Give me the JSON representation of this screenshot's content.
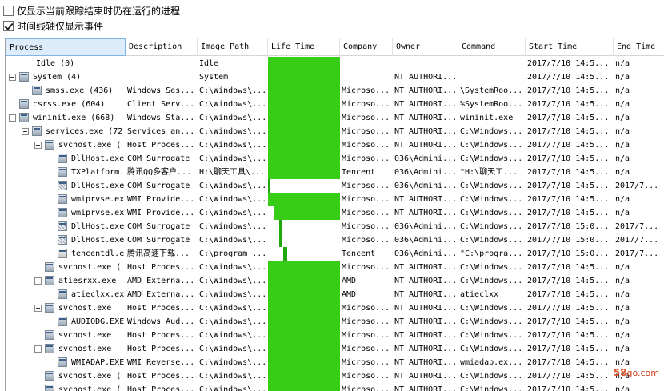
{
  "options": {
    "only_running": {
      "label": "仅显示当前跟踪结束时仍在运行的进程",
      "checked": false
    },
    "timeline_only": {
      "label": "时间线轴仅显示事件",
      "checked": true
    }
  },
  "columns": [
    "Process",
    "Description",
    "Image Path",
    "Life Time",
    "Company",
    "Owner",
    "Command",
    "Start Time",
    "End Time"
  ],
  "rows": [
    {
      "depth": 0,
      "expand": false,
      "icon": "none",
      "process": "Idle (0)",
      "description": "",
      "image_path": "Idle",
      "lifetime": {
        "start": 0,
        "end": 1
      },
      "company": "",
      "owner": "",
      "command": "",
      "start_time": "2017/7/10 14:5...",
      "end_time": "n/a"
    },
    {
      "depth": 0,
      "expand": true,
      "icon": "process",
      "process": "System (4)",
      "description": "",
      "image_path": "System",
      "lifetime": {
        "start": 0,
        "end": 1
      },
      "company": "",
      "owner": "NT AUTHORI...",
      "command": "",
      "start_time": "2017/7/10 14:5...",
      "end_time": "n/a"
    },
    {
      "depth": 1,
      "expand": false,
      "icon": "process",
      "process": "smss.exe (436)",
      "description": "Windows Ses...",
      "image_path": "C:\\Windows\\...",
      "lifetime": {
        "start": 0,
        "end": 1
      },
      "company": "Microso...",
      "owner": "NT AUTHORI...",
      "command": "\\SystemRoo...",
      "start_time": "2017/7/10 14:5...",
      "end_time": "n/a"
    },
    {
      "depth": 0,
      "expand": false,
      "icon": "process",
      "process": "csrss.exe (604)",
      "description": "Client Serv...",
      "image_path": "C:\\Windows\\...",
      "lifetime": {
        "start": 0,
        "end": 1
      },
      "company": "Microso...",
      "owner": "NT AUTHORI...",
      "command": "%SystemRoo...",
      "start_time": "2017/7/10 14:5...",
      "end_time": "n/a"
    },
    {
      "depth": 0,
      "expand": true,
      "icon": "process",
      "process": "wininit.exe (668)",
      "description": "Windows Sta...",
      "image_path": "C:\\Windows\\...",
      "lifetime": {
        "start": 0,
        "end": 1
      },
      "company": "Microso...",
      "owner": "NT AUTHORI...",
      "command": "wininit.exe",
      "start_time": "2017/7/10 14:5...",
      "end_time": "n/a"
    },
    {
      "depth": 1,
      "expand": true,
      "icon": "process",
      "process": "services.exe (72",
      "description": "Services an...",
      "image_path": "C:\\Windows\\...",
      "lifetime": {
        "start": 0,
        "end": 1
      },
      "company": "Microso...",
      "owner": "NT AUTHORI...",
      "command": "C:\\Windows...",
      "start_time": "2017/7/10 14:5...",
      "end_time": "n/a"
    },
    {
      "depth": 2,
      "expand": true,
      "icon": "process",
      "process": "svchost.exe (",
      "description": "Host Proces...",
      "image_path": "C:\\Windows\\...",
      "lifetime": {
        "start": 0,
        "end": 1
      },
      "company": "Microso...",
      "owner": "NT AUTHORI...",
      "command": "C:\\Windows...",
      "start_time": "2017/7/10 14:5...",
      "end_time": "n/a"
    },
    {
      "depth": 3,
      "expand": false,
      "icon": "process",
      "process": "DllHost.exe",
      "description": "COM Surrogate",
      "image_path": "C:\\Windows\\...",
      "lifetime": {
        "start": 0,
        "end": 1
      },
      "company": "Microso...",
      "owner": "036\\Admini...",
      "command": "C:\\Windows...",
      "start_time": "2017/7/10 14:5...",
      "end_time": "n/a"
    },
    {
      "depth": 3,
      "expand": false,
      "icon": "process",
      "process": "TXPlatform.",
      "description": "腾讯QQ多客户...",
      "image_path": "H:\\聊天工具\\...",
      "lifetime": {
        "start": 0,
        "end": 1
      },
      "company": "Tencent",
      "owner": "036\\Admini...",
      "command": "\"H:\\聊天工...",
      "start_time": "2017/7/10 14:5...",
      "end_time": "n/a"
    },
    {
      "depth": 3,
      "expand": false,
      "icon": "dotted",
      "process": "DllHost.exe",
      "description": "COM Surrogate",
      "image_path": "C:\\Windows\\...",
      "lifetime": {
        "start": 0,
        "end": 0.03
      },
      "company": "Microso...",
      "owner": "036\\Admini...",
      "command": "C:\\Windows...",
      "start_time": "2017/7/10 14:5...",
      "end_time": "2017/7..."
    },
    {
      "depth": 3,
      "expand": false,
      "icon": "process",
      "process": "wmiprvse.ex",
      "description": "WMI Provide...",
      "image_path": "C:\\Windows\\...",
      "lifetime": {
        "start": 0,
        "end": 1
      },
      "company": "Microso...",
      "owner": "NT AUTHORI...",
      "command": "C:\\Windows...",
      "start_time": "2017/7/10 14:5...",
      "end_time": "n/a"
    },
    {
      "depth": 3,
      "expand": false,
      "icon": "process",
      "process": "wmiprvse.ex",
      "description": "WMI Provide...",
      "image_path": "C:\\Windows\\...",
      "lifetime": {
        "start": 0.08,
        "end": 1
      },
      "company": "Microso...",
      "owner": "NT AUTHORI...",
      "command": "C:\\Windows...",
      "start_time": "2017/7/10 14:5...",
      "end_time": "n/a"
    },
    {
      "depth": 3,
      "expand": false,
      "icon": "dotted",
      "process": "DllHost.exe",
      "description": "COM Surrogate",
      "image_path": "C:\\Windows\\...",
      "lifetime": {
        "start": 0.15,
        "end": 0.18
      },
      "company": "Microso...",
      "owner": "036\\Admini...",
      "command": "C:\\Windows...",
      "start_time": "2017/7/10 15:0...",
      "end_time": "2017/7..."
    },
    {
      "depth": 3,
      "expand": false,
      "icon": "dotted",
      "process": "DllHost.exe",
      "description": "COM Surrogate",
      "image_path": "C:\\Windows\\...",
      "lifetime": {
        "start": 0.16,
        "end": 0.19
      },
      "company": "Microso...",
      "owner": "036\\Admini...",
      "command": "C:\\Windows...",
      "start_time": "2017/7/10 15:0...",
      "end_time": "2017/7..."
    },
    {
      "depth": 3,
      "expand": false,
      "icon": "chat",
      "process": "tencentdl.e",
      "description": "腾讯高速下载...",
      "image_path": "C:\\program ...",
      "lifetime": {
        "start": 0.21,
        "end": 0.26
      },
      "company": "Tencent",
      "owner": "036\\Admini...",
      "command": "\"C:\\progra...",
      "start_time": "2017/7/10 15:0...",
      "end_time": "2017/7..."
    },
    {
      "depth": 2,
      "expand": false,
      "icon": "process",
      "process": "svchost.exe (",
      "description": "Host Proces...",
      "image_path": "C:\\Windows\\...",
      "lifetime": {
        "start": 0,
        "end": 1
      },
      "company": "Microso...",
      "owner": "NT AUTHORI...",
      "command": "C:\\Windows...",
      "start_time": "2017/7/10 14:5...",
      "end_time": "n/a"
    },
    {
      "depth": 2,
      "expand": true,
      "icon": "process",
      "process": "atiesrxx.exe",
      "description": "AMD Externa...",
      "image_path": "C:\\Windows\\...",
      "lifetime": {
        "start": 0,
        "end": 1
      },
      "company": "AMD",
      "owner": "NT AUTHORI...",
      "command": "C:\\Windows...",
      "start_time": "2017/7/10 14:5...",
      "end_time": "n/a"
    },
    {
      "depth": 3,
      "expand": false,
      "icon": "process",
      "process": "atieclxx.ex",
      "description": "AMD Externa...",
      "image_path": "C:\\Windows\\...",
      "lifetime": {
        "start": 0,
        "end": 1
      },
      "company": "AMD",
      "owner": "NT AUTHORI...",
      "command": "atieclxx",
      "start_time": "2017/7/10 14:5...",
      "end_time": "n/a"
    },
    {
      "depth": 2,
      "expand": true,
      "icon": "process",
      "process": "svchost.exe",
      "description": "Host Proces...",
      "image_path": "C:\\Windows\\...",
      "lifetime": {
        "start": 0,
        "end": 1
      },
      "company": "Microso...",
      "owner": "NT AUTHORI...",
      "command": "C:\\Windows...",
      "start_time": "2017/7/10 14:5...",
      "end_time": "n/a"
    },
    {
      "depth": 3,
      "expand": false,
      "icon": "process",
      "process": "AUDIODG.EXE",
      "description": "Windows Aud...",
      "image_path": "C:\\Windows\\...",
      "lifetime": {
        "start": 0,
        "end": 1
      },
      "company": "Microso...",
      "owner": "NT AUTHORI...",
      "command": "C:\\Windows...",
      "start_time": "2017/7/10 14:5...",
      "end_time": "n/a"
    },
    {
      "depth": 2,
      "expand": false,
      "icon": "process",
      "process": "svchost.exe",
      "description": "Host Proces...",
      "image_path": "C:\\Windows\\...",
      "lifetime": {
        "start": 0,
        "end": 1
      },
      "company": "Microso...",
      "owner": "NT AUTHORI...",
      "command": "C:\\Windows...",
      "start_time": "2017/7/10 14:5...",
      "end_time": "n/a"
    },
    {
      "depth": 2,
      "expand": true,
      "icon": "process",
      "process": "svchost.exe",
      "description": "Host Proces...",
      "image_path": "C:\\Windows\\...",
      "lifetime": {
        "start": 0,
        "end": 1
      },
      "company": "Microso...",
      "owner": "NT AUTHORI...",
      "command": "C:\\Windows...",
      "start_time": "2017/7/10 14:5...",
      "end_time": "n/a"
    },
    {
      "depth": 3,
      "expand": false,
      "icon": "process",
      "process": "WMIADAP.EXE",
      "description": "WMI Reverse...",
      "image_path": "C:\\Windows\\...",
      "lifetime": {
        "start": 0,
        "end": 1
      },
      "company": "Microso...",
      "owner": "NT AUTHORI...",
      "command": "wmiadap.ex...",
      "start_time": "2017/7/10 14:5...",
      "end_time": "n/a"
    },
    {
      "depth": 2,
      "expand": false,
      "icon": "process",
      "process": "svchost.exe (",
      "description": "Host Proces...",
      "image_path": "C:\\Windows\\...",
      "lifetime": {
        "start": 0,
        "end": 1
      },
      "company": "Microso...",
      "owner": "NT AUTHORI...",
      "command": "C:\\Windows...",
      "start_time": "2017/7/10 14:5...",
      "end_time": "n/a"
    },
    {
      "depth": 2,
      "expand": false,
      "icon": "process",
      "process": "svchost.exe (",
      "description": "Host Proces...",
      "image_path": "C:\\Windows\\...",
      "lifetime": {
        "start": 0,
        "end": 1
      },
      "company": "Microso...",
      "owner": "NT AUTHORI...",
      "command": "C:\\Windows...",
      "start_time": "2017/7/10 14:5...",
      "end_time": "n/a"
    }
  ],
  "watermark": {
    "a": "58",
    "b": "go.com"
  },
  "colors": {
    "lifetime_bar": "#37cc16",
    "lifetime_bar_short": "#1fa80b",
    "header_selected": "#dcecfb"
  }
}
